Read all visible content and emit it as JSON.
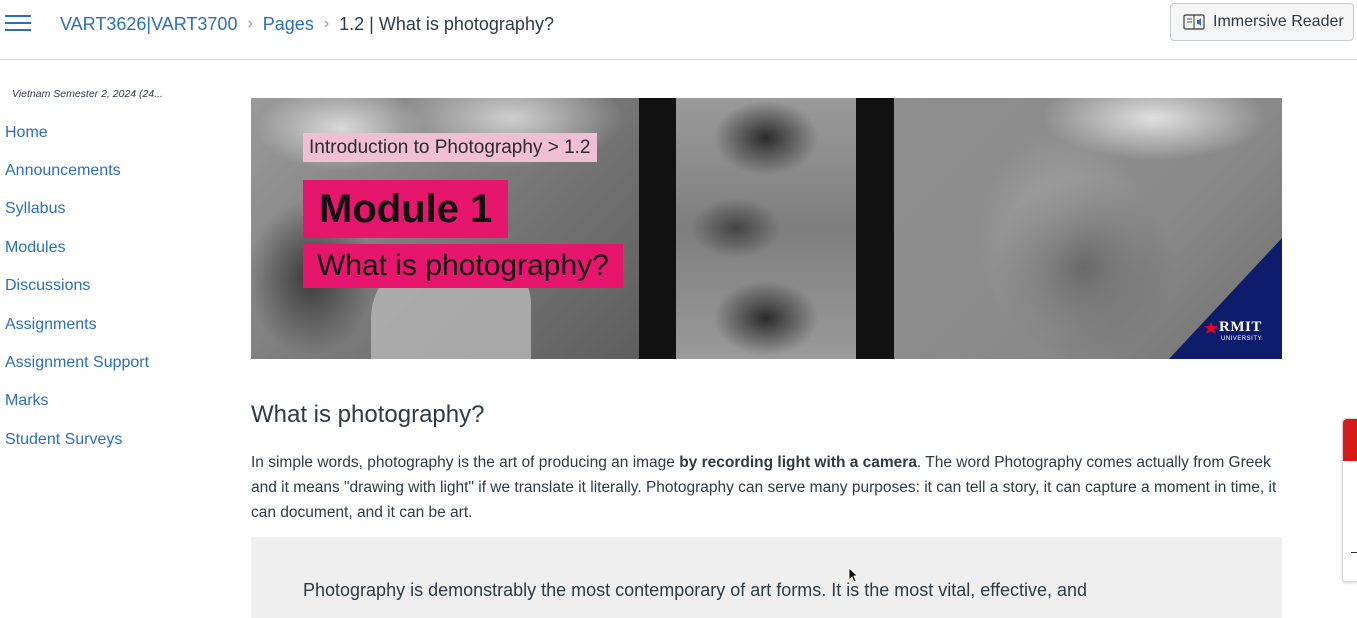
{
  "header": {
    "breadcrumb": {
      "course": "VART3626|VART3700",
      "section": "Pages",
      "current": "1.2 | What is photography?"
    },
    "immersive_reader_label": "Immersive Reader"
  },
  "sidebar": {
    "term": "Vietnam Semester 2, 2024 (24...",
    "items": [
      {
        "label": "Home"
      },
      {
        "label": "Announcements"
      },
      {
        "label": "Syllabus"
      },
      {
        "label": "Modules"
      },
      {
        "label": "Discussions"
      },
      {
        "label": "Assignments"
      },
      {
        "label": "Assignment Support"
      },
      {
        "label": "Marks"
      },
      {
        "label": "Student Surveys"
      }
    ]
  },
  "banner": {
    "tag": "Introduction to Photography > 1.2",
    "module": "Module 1",
    "subtitle": "What is photography?",
    "logo": "RMIT",
    "logo_sub": "UNIVERSITY"
  },
  "content": {
    "heading": "What is photography?",
    "para_part1": "In simple words, photography is the art of producing an image ",
    "para_bold": "by recording light with a camera",
    "para_part2": ". The word Photography comes actually from Greek and it means \"drawing with light\" if we translate it literally. Photography can serve many purposes: it can tell a story, it can capture a moment in time, it can document, and it can be art.",
    "quote": "Photography is demonstrably the most contemporary of art forms. It is the most vital, effective, and"
  },
  "colors": {
    "link": "#2b6ebd",
    "banner_pink": "#e5166c",
    "banner_tag_pink": "#f1bfd3",
    "rmit_blue": "#0d1d6b",
    "quote_bg": "#efefef"
  }
}
